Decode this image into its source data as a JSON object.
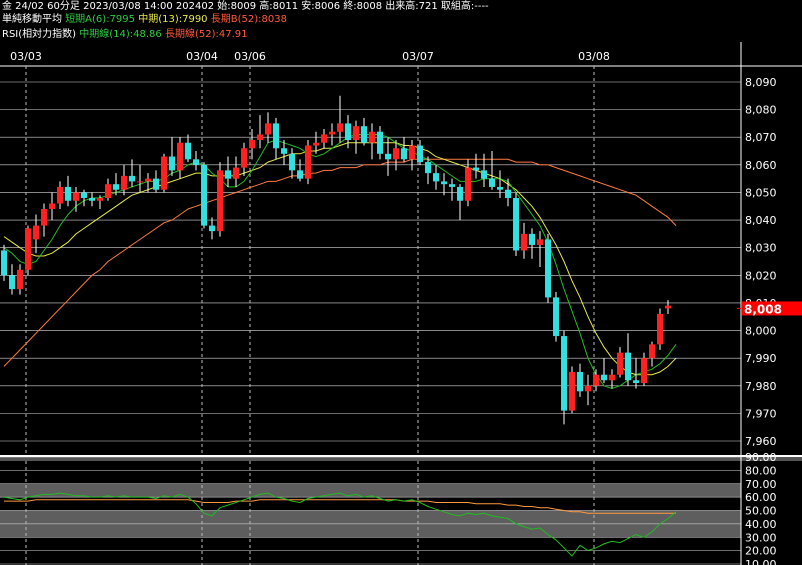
{
  "header": {
    "line1": "金 24/02 60分足 2023/03/08 14:00 202402 始:8009 高:8011 安:8006 終:8008 出来高:721 取組高:----",
    "ma_title": "単純移動平均",
    "ma_short": "短期A(6):7995",
    "ma_mid": "中期(13):7990",
    "ma_long": "長期B(52):8038",
    "rsi_title": "RSI(相対力指数)",
    "rsi_mid": "中期線(14):48.86",
    "rsi_long": "長期線(52):47.91"
  },
  "colors": {
    "up": "#ff2020",
    "down": "#33e0e0",
    "ma_short": "#22bb22",
    "ma_mid": "#e8e84a",
    "ma_long": "#ff7a40",
    "rsi14": "#22bb22",
    "rsi52": "#ff9a40",
    "last_price_bg": "#ff0000"
  },
  "chart_data": [
    {
      "type": "candlestick",
      "date_labels": [
        {
          "label": "03/03",
          "index": 3
        },
        {
          "label": "03/04",
          "index": 25
        },
        {
          "label": "03/06",
          "index": 31
        },
        {
          "label": "03/07",
          "index": 52
        },
        {
          "label": "03/08",
          "index": 74
        }
      ],
      "ylim": [
        7960,
        8095
      ],
      "yticks": [
        "8,090",
        "8,080",
        "8,070",
        "8,060",
        "8,050",
        "8,040",
        "8,030",
        "8,020",
        "8,010",
        "8,000",
        "7,990",
        "7,980",
        "7,970",
        "7,960"
      ],
      "last_price": "8,008",
      "candles": [
        [
          8029,
          8031,
          8018,
          8020
        ],
        [
          8020,
          8024,
          8013,
          8015
        ],
        [
          8015,
          8024,
          8013,
          8022
        ],
        [
          8022,
          8038,
          8020,
          8037
        ],
        [
          8033,
          8042,
          8028,
          8038
        ],
        [
          8038,
          8046,
          8034,
          8044
        ],
        [
          8044,
          8050,
          8040,
          8046
        ],
        [
          8046,
          8054,
          8044,
          8052
        ],
        [
          8052,
          8056,
          8045,
          8047
        ],
        [
          8047,
          8052,
          8043,
          8050
        ],
        [
          8050,
          8051,
          8045,
          8048
        ],
        [
          8048,
          8050,
          8045,
          8047
        ],
        [
          8047,
          8049,
          8044,
          8048
        ],
        [
          8048,
          8055,
          8047,
          8053
        ],
        [
          8053,
          8057,
          8049,
          8051
        ],
        [
          8051,
          8060,
          8049,
          8056
        ],
        [
          8056,
          8062,
          8052,
          8054
        ],
        [
          8054,
          8060,
          8050,
          8054
        ],
        [
          8054,
          8057,
          8050,
          8055
        ],
        [
          8055,
          8058,
          8050,
          8051
        ],
        [
          8051,
          8064,
          8050,
          8063
        ],
        [
          8063,
          8070,
          8056,
          8058
        ],
        [
          8058,
          8070,
          8055,
          8068
        ],
        [
          8068,
          8071,
          8061,
          8062
        ],
        [
          8062,
          8065,
          8058,
          8060
        ],
        [
          8060,
          8061,
          8037,
          8038
        ],
        [
          8038,
          8041,
          8033,
          8036
        ],
        [
          8036,
          8061,
          8034,
          8058
        ],
        [
          8058,
          8063,
          8052,
          8055
        ],
        [
          8055,
          8063,
          8052,
          8059
        ],
        [
          8059,
          8068,
          8056,
          8066
        ],
        [
          8066,
          8073,
          8062,
          8069
        ],
        [
          8069,
          8078,
          8066,
          8071
        ],
        [
          8071,
          8079,
          8068,
          8075
        ],
        [
          8075,
          8077,
          8062,
          8066
        ],
        [
          8066,
          8069,
          8060,
          8064
        ],
        [
          8064,
          8066,
          8055,
          8058
        ],
        [
          8058,
          8062,
          8054,
          8055
        ],
        [
          8055,
          8069,
          8053,
          8067
        ],
        [
          8067,
          8072,
          8064,
          8068
        ],
        [
          8068,
          8073,
          8066,
          8071
        ],
        [
          8071,
          8075,
          8067,
          8072
        ],
        [
          8072,
          8085,
          8068,
          8075
        ],
        [
          8075,
          8078,
          8066,
          8069
        ],
        [
          8069,
          8076,
          8064,
          8074
        ],
        [
          8074,
          8077,
          8067,
          8068
        ],
        [
          8068,
          8075,
          8062,
          8072
        ],
        [
          8072,
          8074,
          8062,
          8064
        ],
        [
          8064,
          8070,
          8056,
          8062
        ],
        [
          8062,
          8069,
          8058,
          8066
        ],
        [
          8066,
          8070,
          8061,
          8062
        ],
        [
          8062,
          8069,
          8058,
          8067
        ],
        [
          8067,
          8069,
          8060,
          8061
        ],
        [
          8061,
          8063,
          8053,
          8057
        ],
        [
          8057,
          8060,
          8051,
          8054
        ],
        [
          8054,
          8057,
          8049,
          8053
        ],
        [
          8053,
          8055,
          8047,
          8052
        ],
        [
          8052,
          8053,
          8040,
          8047
        ],
        [
          8047,
          8062,
          8045,
          8059
        ],
        [
          8059,
          8064,
          8055,
          8058
        ],
        [
          8058,
          8064,
          8052,
          8055
        ],
        [
          8055,
          8065,
          8051,
          8052
        ],
        [
          8052,
          8058,
          8048,
          8051
        ],
        [
          8051,
          8055,
          8045,
          8048
        ],
        [
          8048,
          8050,
          8027,
          8029
        ],
        [
          8029,
          8039,
          8026,
          8035
        ],
        [
          8035,
          8037,
          8026,
          8031
        ],
        [
          8031,
          8036,
          8023,
          8033
        ],
        [
          8033,
          8035,
          8010,
          8012
        ],
        [
          8012,
          8014,
          7996,
          7998
        ],
        [
          7998,
          8000,
          7966,
          7971
        ],
        [
          7971,
          7987,
          7970,
          7985
        ],
        [
          7985,
          7988,
          7976,
          7978
        ],
        [
          7978,
          7984,
          7973,
          7980
        ],
        [
          7980,
          7986,
          7978,
          7984
        ],
        [
          7984,
          7990,
          7981,
          7982
        ],
        [
          7982,
          7986,
          7979,
          7984
        ],
        [
          7984,
          7994,
          7983,
          7992
        ],
        [
          7992,
          7999,
          7980,
          7982
        ],
        [
          7982,
          7990,
          7979,
          7981
        ],
        [
          7981,
          7992,
          7980,
          7990
        ],
        [
          7990,
          7996,
          7987,
          7995
        ],
        [
          7995,
          8008,
          7993,
          8006
        ],
        [
          8008,
          8011,
          8006,
          8009
        ]
      ],
      "ma_short_6": [
        8030,
        8028,
        8025,
        8024,
        8025,
        8029,
        8033,
        8038,
        8042,
        8045,
        8047,
        8048,
        8048,
        8049,
        8050,
        8051,
        8052,
        8053,
        8054,
        8054,
        8055,
        8057,
        8058,
        8060,
        8061,
        8060,
        8057,
        8055,
        8052,
        8052,
        8054,
        8058,
        8063,
        8068,
        8069,
        8068,
        8067,
        8066,
        8064,
        8063,
        8064,
        8066,
        8068,
        8070,
        8071,
        8071,
        8071,
        8071,
        8070,
        8068,
        8066,
        8065,
        8063,
        8062,
        8060,
        8058,
        8056,
        8054,
        8054,
        8054,
        8055,
        8055,
        8055,
        8054,
        8050,
        8046,
        8042,
        8038,
        8032,
        8024,
        8015,
        8007,
        7999,
        7990,
        7984,
        7980,
        7979,
        7980,
        7982,
        7984,
        7985,
        7986,
        7988,
        7991,
        7995
      ],
      "ma_mid_13": [
        8034,
        8032,
        8030,
        8028,
        8027,
        8027,
        8028,
        8030,
        8032,
        8035,
        8037,
        8039,
        8041,
        8043,
        8045,
        8047,
        8049,
        8050,
        8051,
        8052,
        8053,
        8054,
        8055,
        8056,
        8057,
        8057,
        8056,
        8056,
        8056,
        8056,
        8057,
        8058,
        8059,
        8061,
        8062,
        8063,
        8064,
        8064,
        8065,
        8065,
        8066,
        8066,
        8067,
        8068,
        8068,
        8068,
        8068,
        8068,
        8068,
        8068,
        8067,
        8067,
        8066,
        8065,
        8063,
        8062,
        8061,
        8060,
        8059,
        8058,
        8057,
        8056,
        8055,
        8053,
        8051,
        8048,
        8045,
        8041,
        8036,
        8031,
        8025,
        8018,
        8012,
        8005,
        7999,
        7994,
        7990,
        7987,
        7985,
        7984,
        7984,
        7984,
        7985,
        7987,
        7990
      ],
      "ma_long_52": [
        7987,
        7990,
        7993,
        7996,
        7999,
        8002,
        8005,
        8008,
        8011,
        8014,
        8017,
        8020,
        8022,
        8025,
        8027,
        8029,
        8031,
        8033,
        8035,
        8037,
        8039,
        8040,
        8042,
        8044,
        8045,
        8046,
        8047,
        8048,
        8049,
        8050,
        8051,
        8052,
        8053,
        8054,
        8054,
        8055,
        8056,
        8056,
        8057,
        8057,
        8058,
        8058,
        8059,
        8059,
        8059,
        8060,
        8060,
        8060,
        8061,
        8061,
        8061,
        8062,
        8062,
        8062,
        8062,
        8062,
        8062,
        8062,
        8062,
        8062,
        8062,
        8062,
        8062,
        8062,
        8061,
        8061,
        8061,
        8060,
        8060,
        8059,
        8058,
        8057,
        8056,
        8055,
        8054,
        8053,
        8052,
        8051,
        8050,
        8049,
        8047,
        8045,
        8043,
        8041,
        8038
      ],
      "rsi": {
        "yticks": [
          "90.00",
          "80.00",
          "70.00",
          "60.00",
          "50.00",
          "40.00",
          "30.00",
          "20.00",
          "10.00"
        ],
        "ylim": [
          8,
          92
        ],
        "bands": [
          [
            30,
            50
          ],
          [
            60,
            70
          ]
        ],
        "rsi14": [
          60,
          59,
          58,
          60,
          61,
          62,
          62,
          63,
          62,
          61,
          61,
          60,
          60,
          61,
          60,
          61,
          60,
          60,
          60,
          59,
          61,
          60,
          62,
          60,
          55,
          48,
          46,
          52,
          54,
          56,
          58,
          60,
          62,
          63,
          60,
          59,
          57,
          56,
          59,
          60,
          61,
          62,
          63,
          61,
          62,
          60,
          61,
          59,
          57,
          58,
          57,
          58,
          56,
          53,
          51,
          49,
          47,
          46,
          48,
          47,
          48,
          46,
          45,
          44,
          40,
          38,
          36,
          37,
          32,
          28,
          22,
          16,
          24,
          20,
          22,
          25,
          27,
          26,
          29,
          32,
          30,
          34,
          40,
          44,
          49
        ],
        "rsi52": [
          57,
          57,
          57,
          57,
          58,
          58,
          58,
          58,
          58,
          58,
          58,
          58,
          58,
          58,
          58,
          58,
          58,
          58,
          58,
          58,
          58,
          58,
          58,
          58,
          57,
          56,
          56,
          56,
          56,
          57,
          57,
          57,
          58,
          58,
          58,
          58,
          58,
          58,
          58,
          58,
          58,
          58,
          58,
          58,
          58,
          58,
          58,
          58,
          58,
          58,
          57,
          57,
          57,
          57,
          56,
          56,
          56,
          56,
          56,
          55,
          55,
          55,
          55,
          54,
          54,
          53,
          53,
          52,
          52,
          51,
          50,
          49,
          49,
          48,
          48,
          48,
          48,
          48,
          48,
          48,
          48,
          48,
          48,
          48,
          48
        ]
      }
    }
  ]
}
